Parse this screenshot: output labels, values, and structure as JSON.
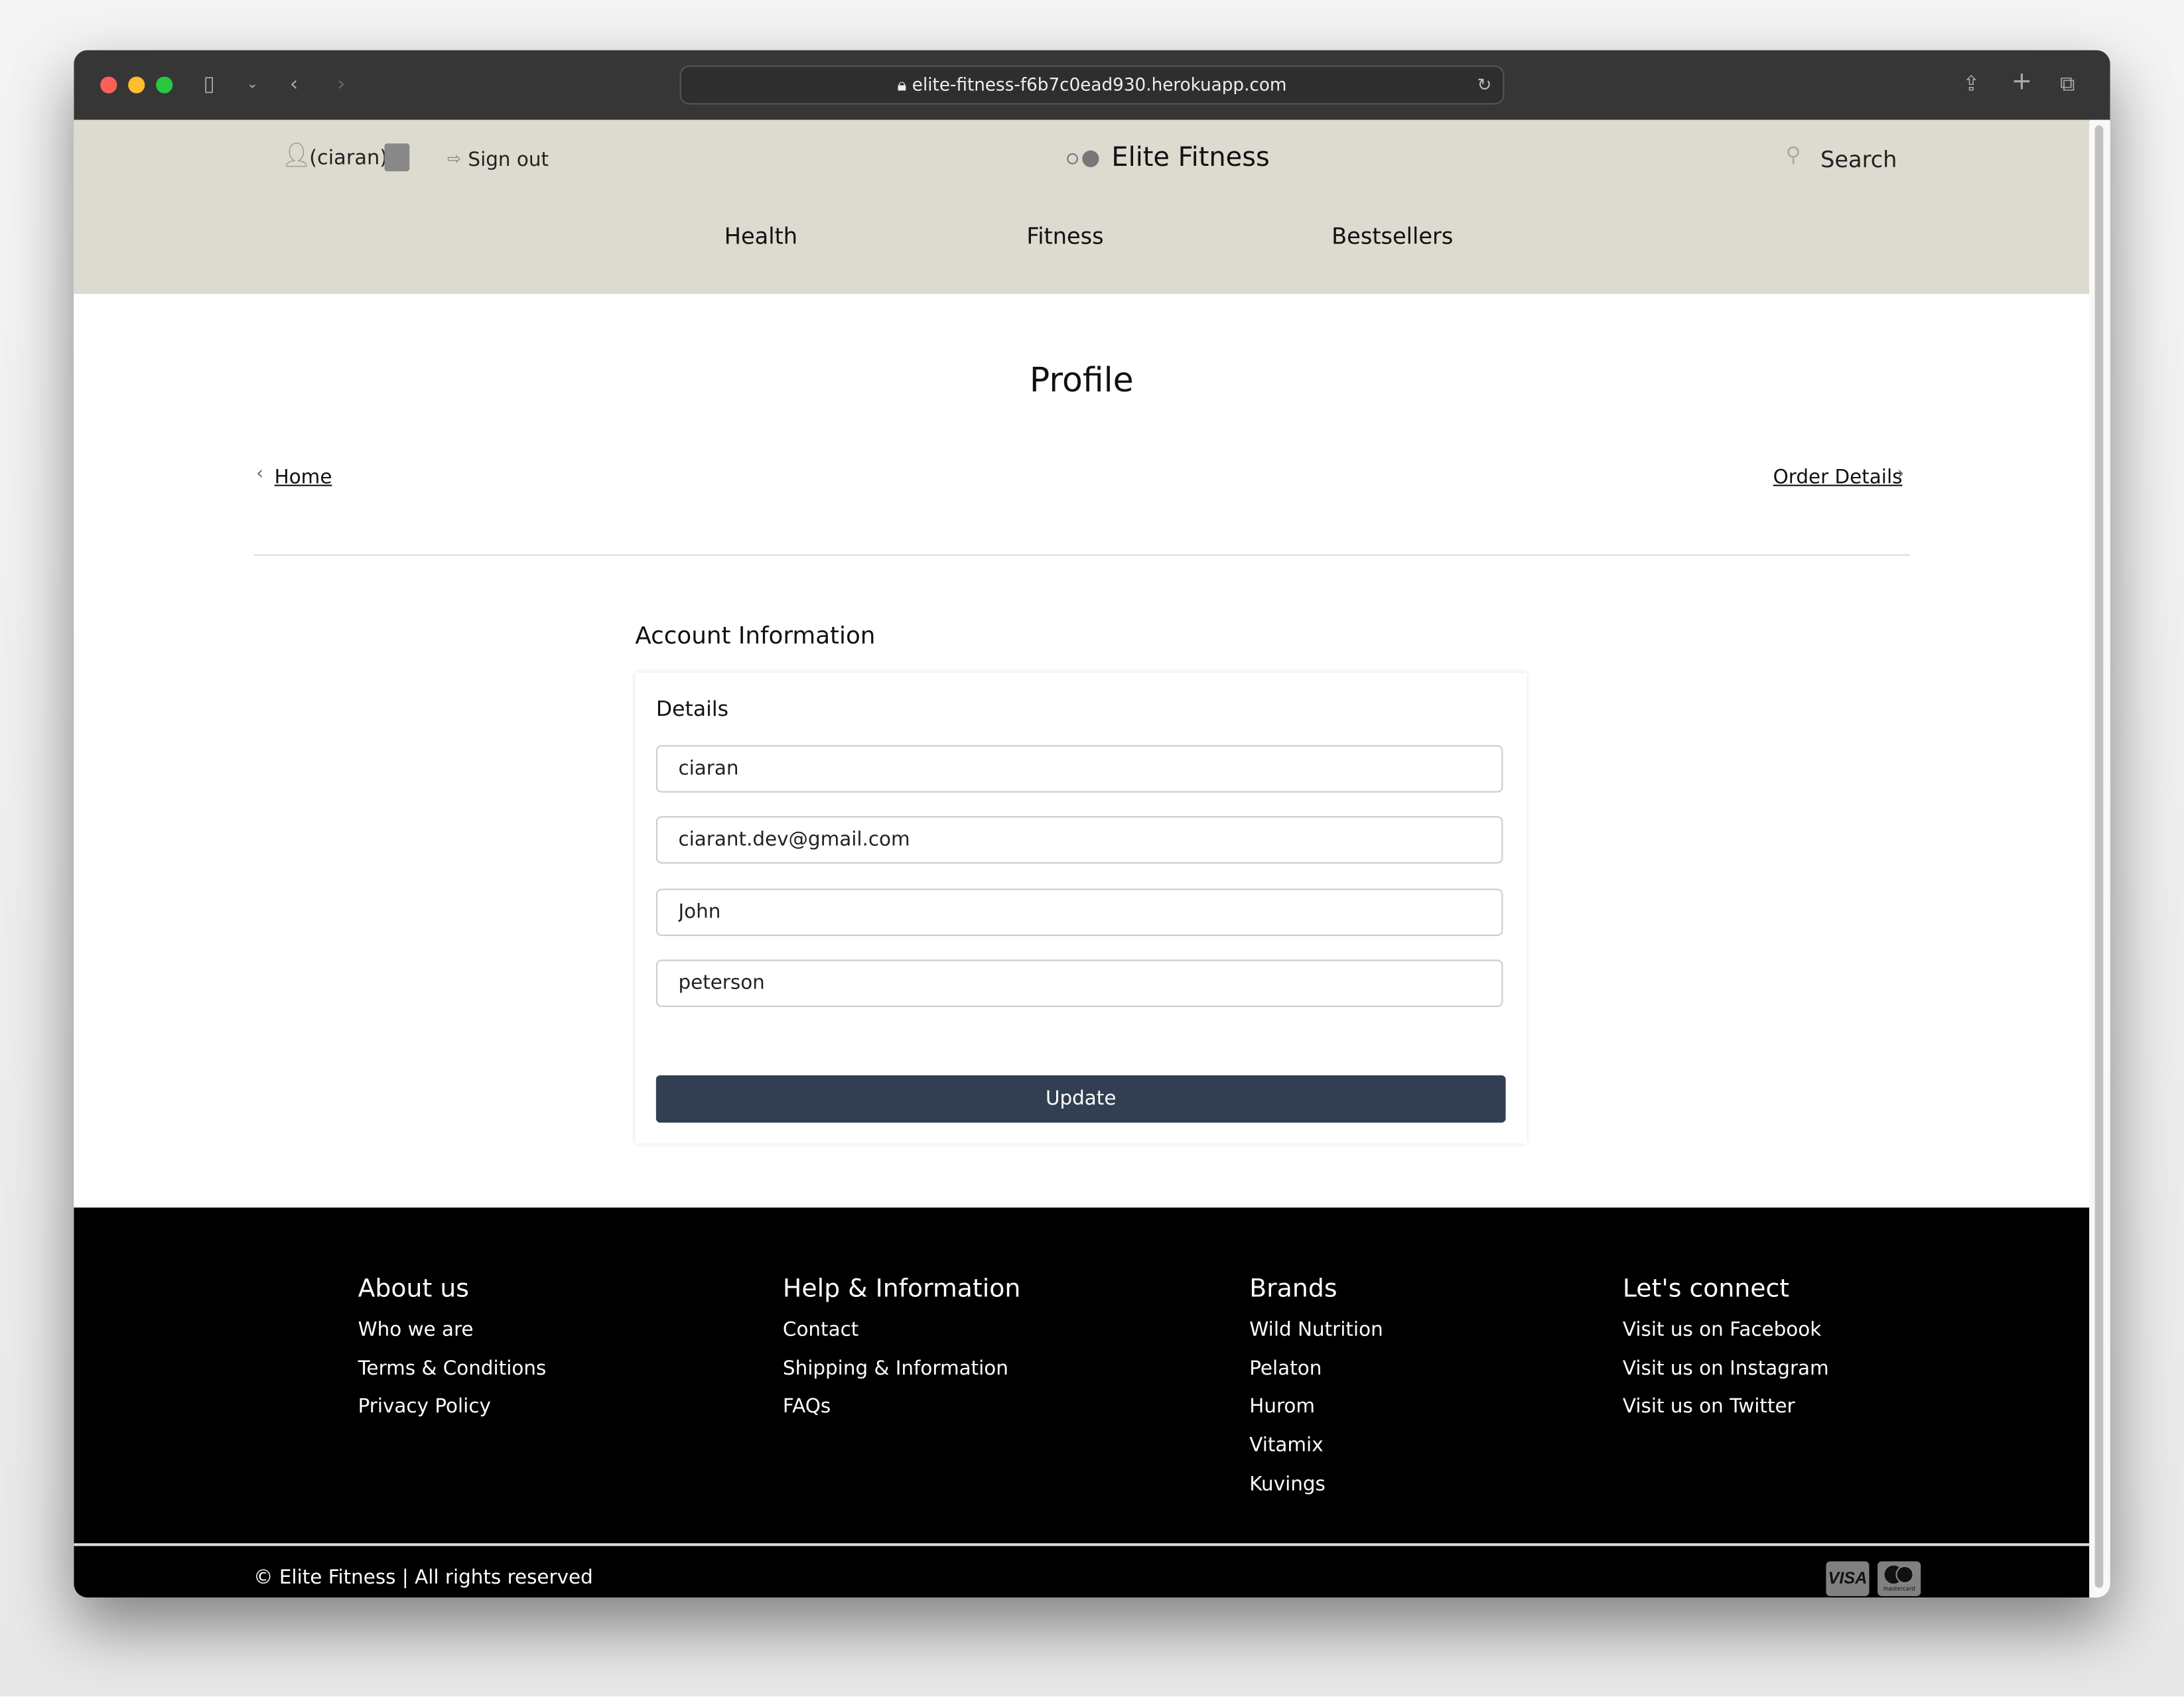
{
  "browser": {
    "url": "elite-fitness-f6b7c0ead930.herokuapp.com"
  },
  "header": {
    "username": "(ciaran)",
    "sign_out": "Sign out",
    "brand": "Elite Fitness",
    "search": "Search",
    "nav": [
      "Health",
      "Fitness",
      "Bestsellers"
    ]
  },
  "main": {
    "title": "Profile",
    "back_link": "Home",
    "next_link": "Order Details",
    "section_title": "Account Information",
    "card_title": "Details",
    "fields": [
      "ciaran",
      "ciarant.dev@gmail.com",
      "John",
      "peterson"
    ],
    "update": "Update"
  },
  "footer": {
    "columns": [
      {
        "title": "About us",
        "items": [
          "Who we are",
          "Terms & Conditions",
          "Privacy Policy"
        ]
      },
      {
        "title": "Help & Information",
        "items": [
          "Contact",
          "Shipping & Information",
          "FAQs"
        ]
      },
      {
        "title": "Brands",
        "items": [
          "Wild Nutrition",
          "Pelaton",
          "Hurom",
          "Vitamix",
          "Kuvings"
        ]
      },
      {
        "title": "Let's connect",
        "items": [
          "Visit us on Facebook",
          "Visit us on Instagram",
          "Visit us on Twitter"
        ]
      }
    ],
    "copyright": "© Elite Fitness | All rights reserved",
    "payment_icons": [
      "VISA",
      "mastercard"
    ]
  }
}
